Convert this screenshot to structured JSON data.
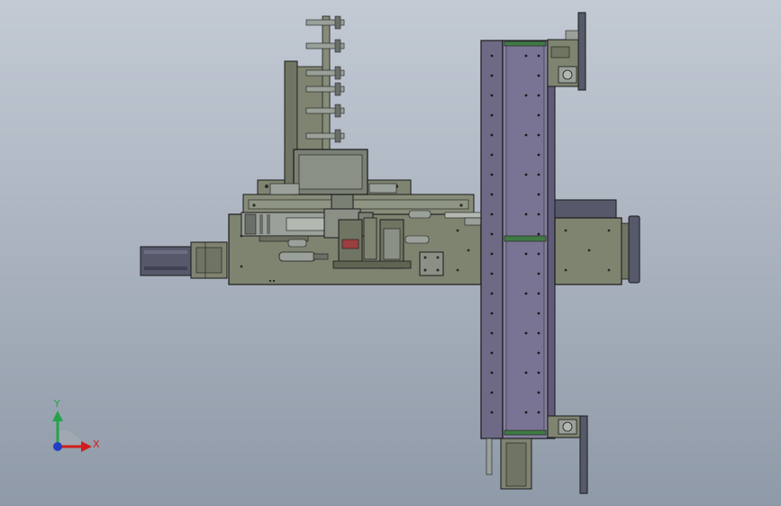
{
  "viewport": {
    "background_top": "#c3cad4",
    "background_bottom": "#8f9aa8"
  },
  "colors": {
    "plate_gray": "#7e8470",
    "plate_gray_dark": "#5f6453",
    "rail_purple": "#6e6a86",
    "rail_purple_light": "#857f9e",
    "outline": "#1a1a1a",
    "steel": "#9aa09a",
    "green_accent": "#3f7a45",
    "dark": "#2b2b2b"
  },
  "triad": {
    "x_label": "X",
    "y_label": "Y",
    "x_color": "#d21d1d",
    "y_color": "#26a34a",
    "origin_color": "#1f3fc4"
  }
}
